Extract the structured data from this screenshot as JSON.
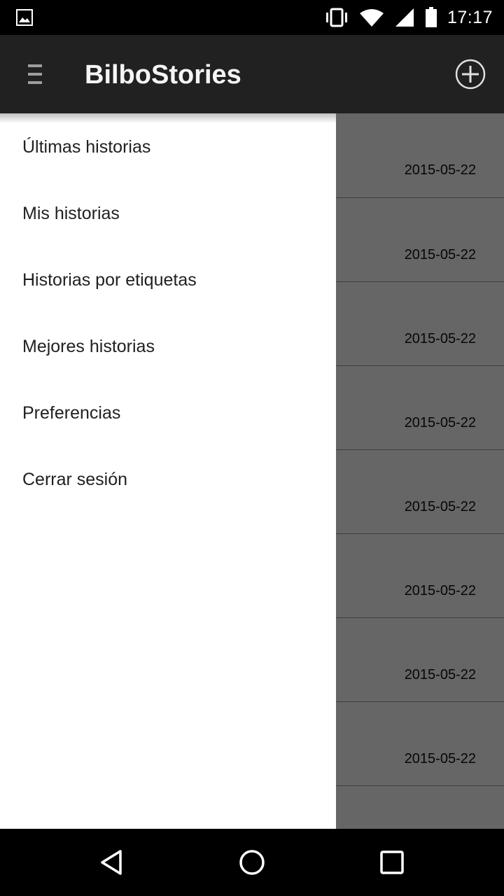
{
  "status_bar": {
    "time": "17:17",
    "icons": [
      "image-notification-icon",
      "vibrate-icon",
      "wifi-icon",
      "signal-icon",
      "battery-icon"
    ]
  },
  "app_bar": {
    "title": "BilboStories",
    "menu_icon": "hamburger-menu-icon",
    "action_icon": "add-circle-icon"
  },
  "drawer": {
    "items": [
      {
        "label": "Últimas historias"
      },
      {
        "label": "Mis historias"
      },
      {
        "label": "Historias por etiquetas"
      },
      {
        "label": "Mejores historias"
      },
      {
        "label": "Preferencias"
      },
      {
        "label": "Cerrar sesión"
      }
    ]
  },
  "stories": [
    {
      "date": "2015-05-22"
    },
    {
      "date": "2015-05-22"
    },
    {
      "date": "2015-05-22"
    },
    {
      "date": "2015-05-22"
    },
    {
      "date": "2015-05-22"
    },
    {
      "date": "2015-05-22"
    },
    {
      "date": "2015-05-22"
    },
    {
      "date": "2015-05-22"
    }
  ],
  "nav_bar": {
    "icons": [
      "back-icon",
      "home-icon",
      "recents-icon"
    ]
  },
  "colors": {
    "app_bar": "#212121",
    "status_bar": "#000000",
    "drawer": "#ffffff",
    "scrim": "#666666"
  }
}
